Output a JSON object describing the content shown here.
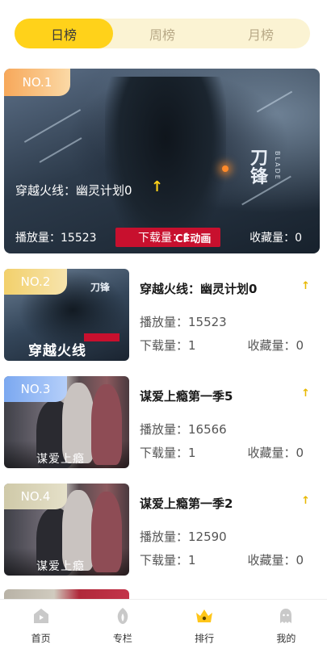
{
  "tabs": [
    {
      "label": "日榜",
      "active": true
    },
    {
      "label": "周榜",
      "active": false
    },
    {
      "label": "月榜",
      "active": false
    }
  ],
  "hero": {
    "rank": "NO.1",
    "title": "穿越火线：幽灵计划0",
    "trend_icon": "arrow-up-icon",
    "play_count": "播放量：15523",
    "download_count": "下载量：1",
    "favorite_count": "收藏量：0",
    "poster_brand": "刀锋",
    "poster_brand_en": "BLADE",
    "poster_logo_text": "CF动画"
  },
  "items": [
    {
      "rank": "NO.2",
      "title": "穿越火线：幽灵计划0",
      "play_count": "播放量：15523",
      "download_count": "下载量：1",
      "favorite_count": "收藏量：0",
      "poster_caption": "穿越火线",
      "poster_brand": "刀锋",
      "badge_color": "#f2d06b"
    },
    {
      "rank": "NO.3",
      "title": "谋爱上瘾第一季5",
      "play_count": "播放量：16566",
      "download_count": "下载量：1",
      "favorite_count": "收藏量：0",
      "poster_caption": "谋爱上瘾",
      "badge_color": "#7ba8f0"
    },
    {
      "rank": "NO.4",
      "title": "谋爱上瘾第一季2",
      "play_count": "播放量：12590",
      "download_count": "下载量：1",
      "favorite_count": "收藏量：0",
      "poster_caption": "谋爱上瘾",
      "badge_color": "#cfc9a8"
    }
  ],
  "nav": [
    {
      "label": "首页",
      "icon": "home-icon",
      "active": false
    },
    {
      "label": "专栏",
      "icon": "column-icon",
      "active": false
    },
    {
      "label": "排行",
      "icon": "crown-icon",
      "active": true
    },
    {
      "label": "我的",
      "icon": "profile-icon",
      "active": false
    }
  ],
  "colors": {
    "accent": "#ffd21a",
    "tab_bg": "#fbf3d3",
    "tab_inactive_text": "#b8a987",
    "arrow": "#e8b800",
    "rank1_badge": "#f7a85a"
  }
}
